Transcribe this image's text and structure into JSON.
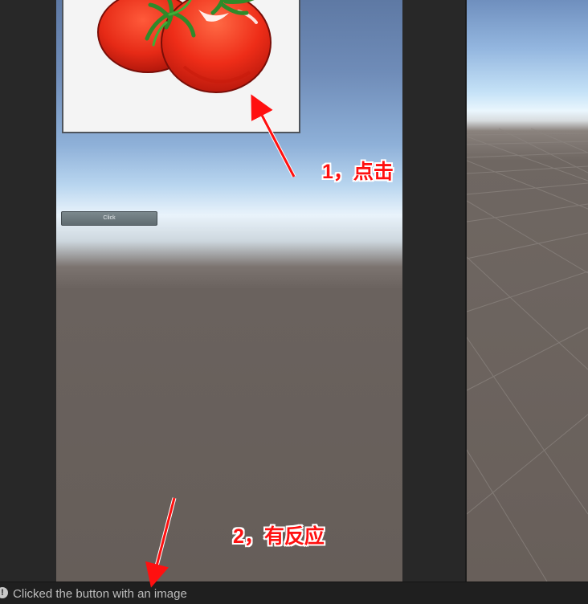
{
  "game_view": {
    "button_label": "Click",
    "image_subject": "tomato-illustration"
  },
  "console": {
    "icon": "warning-exclamation-icon",
    "last_message": "Clicked the button with an image"
  },
  "annotations": {
    "step1": "1，点击",
    "step2": "2，有反应",
    "arrow_color": "#ff1010"
  },
  "colors": {
    "sky_top": "#5e79a4",
    "horizon": "#e9f3fb",
    "ground": "#665e59",
    "editor_bg": "#282828",
    "button": "#6d797e"
  }
}
